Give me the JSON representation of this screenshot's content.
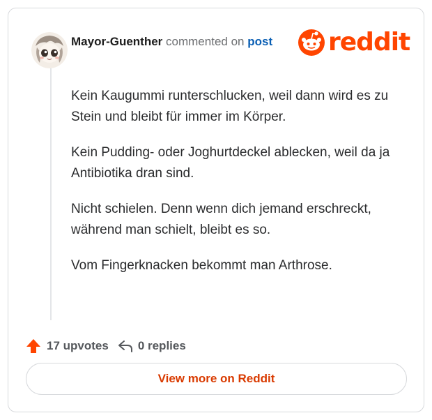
{
  "colors": {
    "brand": "#ff4500",
    "link": "#0a5fb4",
    "button_text": "#d93a00"
  },
  "header": {
    "username": "Mayor-Guenther",
    "verb": "commented on",
    "post_link": "post"
  },
  "logo": {
    "icon": "reddit-snoo-icon",
    "wordmark": "reddit"
  },
  "comment": {
    "paragraphs": [
      "Kein Kaugummi runterschlucken, weil dann wird es zu Stein und bleibt für immer im Körper.",
      "Kein Pudding- oder Joghurtdeckel ablecken, weil da ja Antibiotika dran sind.",
      "Nicht schielen. Denn wenn dich jemand erschreckt, während man schielt, bleibt es so.",
      "Vom Fingerknacken bekommt man Arthrose."
    ]
  },
  "footer": {
    "upvote_icon": "upvote-arrow-icon",
    "upvotes": "17 upvotes",
    "reply_icon": "reply-icon",
    "replies": "0 replies"
  },
  "cta": {
    "label": "View more on Reddit"
  }
}
